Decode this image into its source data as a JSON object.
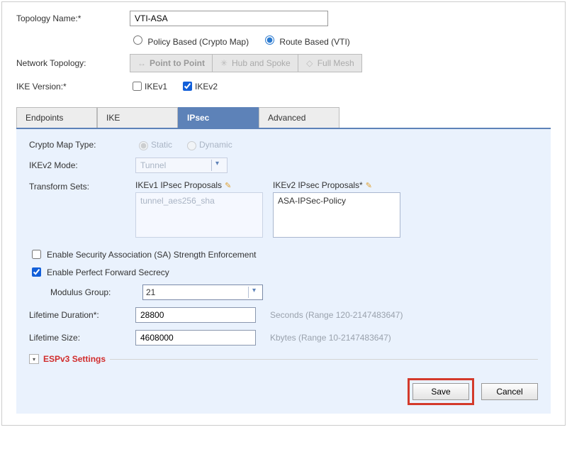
{
  "topology": {
    "name_label": "Topology Name:*",
    "name_value": "VTI-ASA",
    "policy_based": "Policy Based (Crypto Map)",
    "route_based": "Route Based (VTI)",
    "routing": "route"
  },
  "network_topology": {
    "label": "Network Topology:",
    "p2p": "Point to Point",
    "hub": "Hub and Spoke",
    "mesh": "Full Mesh"
  },
  "ike_version": {
    "label": "IKE Version:*",
    "ikev1": "IKEv1",
    "ikev2": "IKEv2"
  },
  "tabs": {
    "endpoints": "Endpoints",
    "ike": "IKE",
    "ipsec": "IPsec",
    "advanced": "Advanced"
  },
  "ipsec": {
    "crypto_label": "Crypto Map Type:",
    "crypto_static": "Static",
    "crypto_dynamic": "Dynamic",
    "ikev2_mode_label": "IKEv2 Mode:",
    "ikev2_mode_value": "Tunnel",
    "transform_label": "Transform Sets:",
    "ikev1_proposals_label": "IKEv1 IPsec Proposals",
    "ikev1_proposal_value": "tunnel_aes256_sha",
    "ikev2_proposals_label": "IKEv2 IPsec Proposals*",
    "ikev2_proposal_value": "ASA-IPSec-Policy",
    "sa_enforce": "Enable Security Association (SA) Strength Enforcement",
    "pfs": "Enable Perfect Forward Secrecy",
    "modulus_label": "Modulus Group:",
    "modulus_value": "21",
    "lifetime_dur_label": "Lifetime Duration*:",
    "lifetime_dur_value": "28800",
    "lifetime_dur_hint": "Seconds (Range 120-2147483647)",
    "lifetime_size_label": "Lifetime Size:",
    "lifetime_size_value": "4608000",
    "lifetime_size_hint": "Kbytes (Range 10-2147483647)",
    "espv3": "ESPv3 Settings"
  },
  "buttons": {
    "save": "Save",
    "cancel": "Cancel"
  }
}
